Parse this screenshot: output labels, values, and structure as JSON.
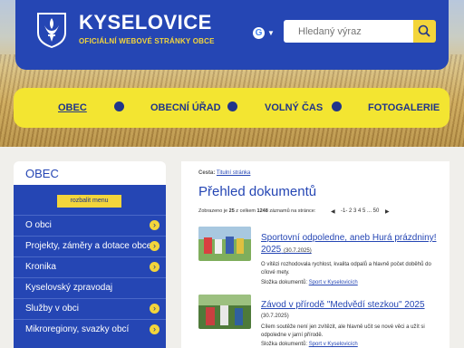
{
  "header": {
    "title": "KYSELOVICE",
    "subtitle": "OFICIÁLNÍ WEBOVÉ STRÁNKY OBCE",
    "search_placeholder": "Hledaný výraz",
    "lang_icon": "google-translate-icon",
    "colors": {
      "brand_blue": "#2546b4",
      "accent_yellow": "#f3d53b"
    }
  },
  "nav": {
    "items": [
      {
        "label": "OBEC",
        "active": true
      },
      {
        "label": "OBECNÍ ÚŘAD"
      },
      {
        "label": "VOLNÝ ČAS"
      },
      {
        "label": "FOTOGALERIE"
      }
    ]
  },
  "sidebar": {
    "title": "OBEC",
    "expand_label": "rozbalit menu",
    "items": [
      {
        "label": "O obci",
        "has_arrow": true
      },
      {
        "label": "Projekty, záměry a dotace obce",
        "has_arrow": true
      },
      {
        "label": "Kronika",
        "has_arrow": true
      },
      {
        "label": "Kyselovský zpravodaj",
        "has_arrow": false
      },
      {
        "label": "Služby v obci",
        "has_arrow": true
      },
      {
        "label": "Mikroregiony, svazky obcí",
        "has_arrow": true
      }
    ]
  },
  "content": {
    "breadcrumb_label": "Cesta:",
    "breadcrumb_link": "Titulní stránka",
    "title": "Přehled dokumentů",
    "paging": {
      "prefix": "Zobrazeno je",
      "shown": "25",
      "middle": "z celkem",
      "total": "1248",
      "suffix": "záznamů na stránce:",
      "pages": "-1- 2 3 4 5 ... 50"
    },
    "docs": [
      {
        "title": "Sportovní odpoledne, aneb Hurá prázdniny! 2025",
        "date": "(30.7.2025)",
        "text": "O vítězi rozhodovala rychlost, kvalita odpalů a hlavně počet doběhů do cílové mety.",
        "folder_label": "Složka dokumentů:",
        "folder_link": "Sport v Kyselovicích"
      },
      {
        "title": "Závod v přírodě \"Medvědí stezkou\" 2025",
        "date": "(30.7.2025)",
        "text": "Cílem soutěže není jen zvítězit, ale hlavně učit se nové věci a užít si odpoledne v jarní přírodě.",
        "folder_label": "Složka dokumentů:",
        "folder_link": "Sport v Kyselovicích"
      }
    ]
  }
}
